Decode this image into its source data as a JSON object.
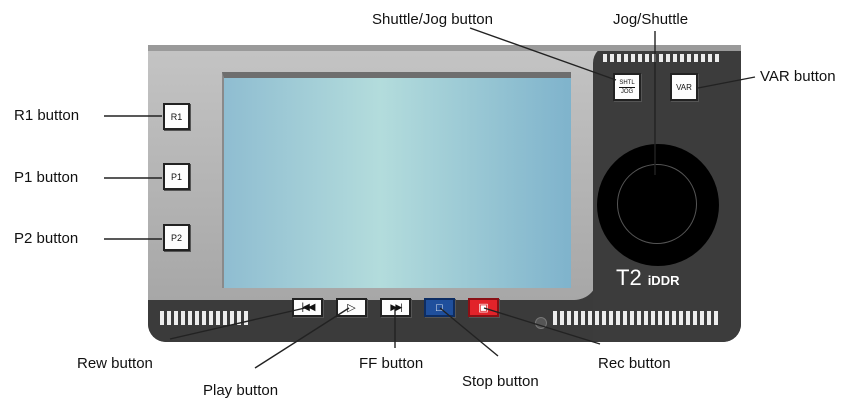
{
  "device": {
    "model": "T2",
    "model_suffix": "iDDR",
    "buttons": {
      "r1": "R1",
      "p1": "P1",
      "p2": "P2",
      "shuttle_jog_line1": "SHTL",
      "shuttle_jog_line2": "JOG",
      "var": "VAR",
      "rew": "|◀◀",
      "play": "▷",
      "ff": "▶▶|",
      "stop": "□",
      "rec": "▣"
    }
  },
  "callouts": {
    "shuttle_jog": "Shuttle/Jog button",
    "jog_shuttle": "Jog/Shuttle",
    "var": "VAR button",
    "r1": "R1 button",
    "p1": "P1 button",
    "p2": "P2 button",
    "rew": "Rew button",
    "play": "Play button",
    "ff": "FF button",
    "stop": "Stop button",
    "rec": "Rec button"
  },
  "colors": {
    "stop_button": "#1f4f9c",
    "rec_button": "#e2232a",
    "screen": "#a9d2da"
  }
}
